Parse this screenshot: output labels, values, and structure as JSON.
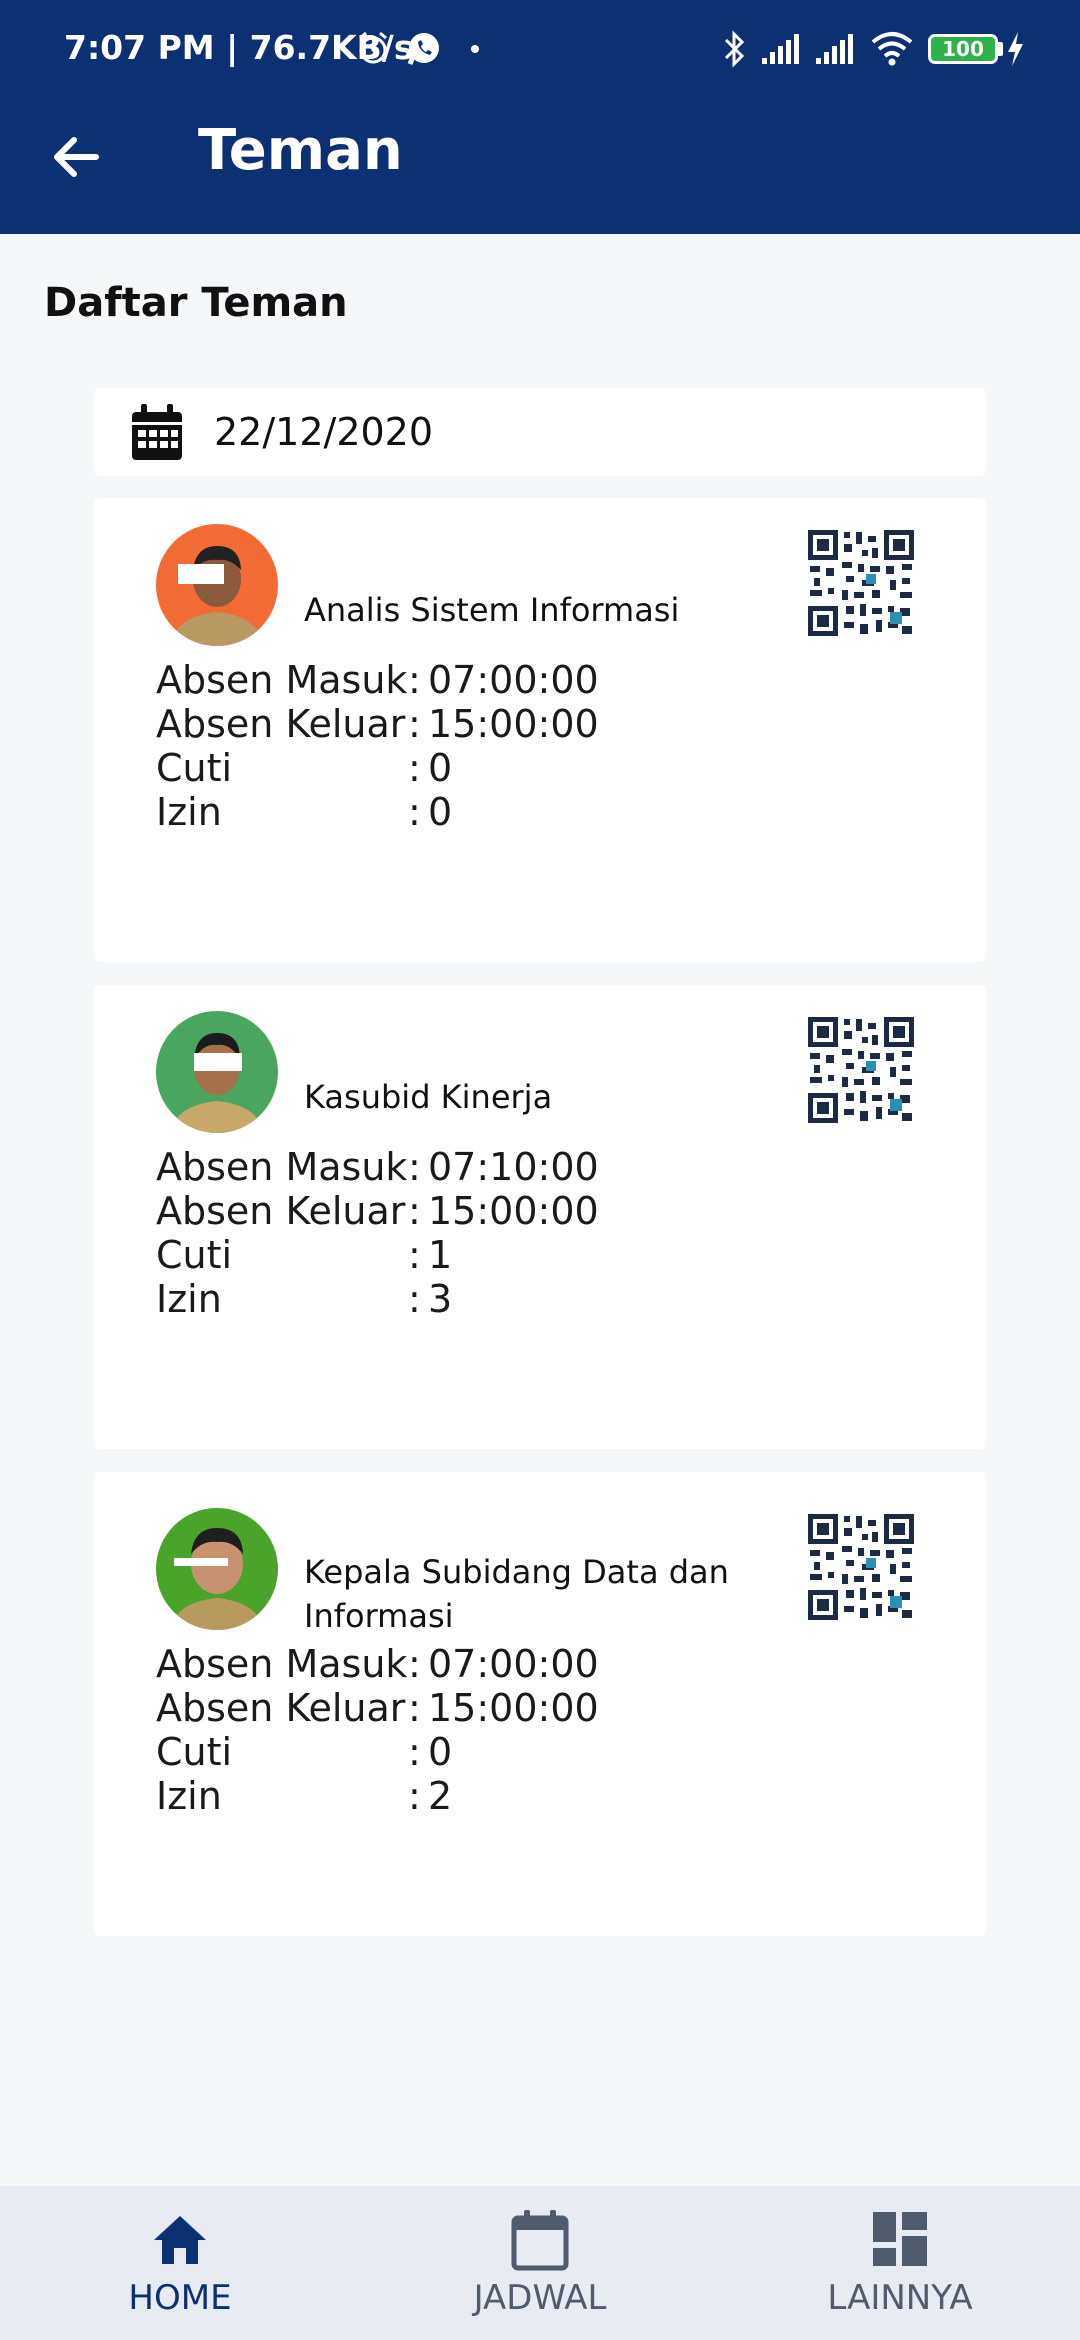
{
  "status_bar": {
    "time": "7:07 PM | 76.7KB/s",
    "battery": "100"
  },
  "app_bar": {
    "title": "Teman",
    "back_icon": "arrow-left-icon"
  },
  "page": {
    "title": "Daftar Teman",
    "date": "22/12/2020",
    "date_icon": "calendar-icon"
  },
  "labels": {
    "masuk": "Absen Masuk",
    "keluar": "Absen Keluar",
    "cuti": "Cuti",
    "izin": "Izin",
    "sep_masuk": ":",
    "sep": ":"
  },
  "friends": [
    {
      "role": "Analis Sistem Informasi",
      "masuk": "07:00:00",
      "keluar": "15:00:00",
      "cuti": "0",
      "izin": "0",
      "avatar_bg": "#f26b35"
    },
    {
      "role": "Kasubid Kinerja",
      "masuk": "07:10:00",
      "keluar": "15:00:00",
      "cuti": "1",
      "izin": "3",
      "avatar_bg": "#4aa55e"
    },
    {
      "role": "Kepala Subidang Data dan Informasi",
      "masuk": "07:00:00",
      "keluar": "15:00:00",
      "cuti": "0",
      "izin": "2",
      "avatar_bg": "#4aa32a"
    }
  ],
  "nav": {
    "home": "HOME",
    "jadwal": "JADWAL",
    "lainnya": "LAINNYA",
    "active_color": "#0b3173",
    "inactive_color": "#505b6e"
  }
}
